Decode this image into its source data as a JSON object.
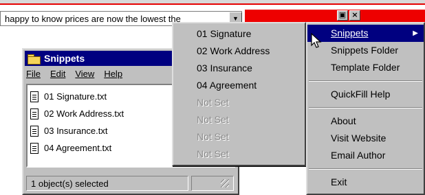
{
  "topbar": {
    "input_value": "happy to know prices are now the lowest the",
    "dropdown_icon": "chevron-down-icon",
    "window_buttons": [
      "maximize-icon",
      "close-icon"
    ]
  },
  "explorer": {
    "title": "Snippets",
    "menu": [
      "File",
      "Edit",
      "View",
      "Help"
    ],
    "files": [
      "01 Signature.txt",
      "02 Work Address.txt",
      "03 Insurance.txt",
      "04 Agreement.txt"
    ],
    "status": "1 object(s) selected"
  },
  "submenu": {
    "items": [
      "01 Signature",
      "02 Work Address",
      "03 Insurance",
      "04 Agreement",
      "Not Set",
      "Not Set",
      "Not Set",
      "Not Set"
    ]
  },
  "menu": {
    "snippets": "Snippets",
    "snippets_folder": "Snippets Folder",
    "template_folder": "Template Folder",
    "quickfill_help": "QuickFill Help",
    "about": "About",
    "visit_website": "Visit Website",
    "email_author": "Email Author",
    "exit": "Exit"
  },
  "colors": {
    "title_bar": "#000080",
    "highlight": "#000080",
    "accent_red": "#ee0000",
    "face": "#c0c0c0"
  }
}
